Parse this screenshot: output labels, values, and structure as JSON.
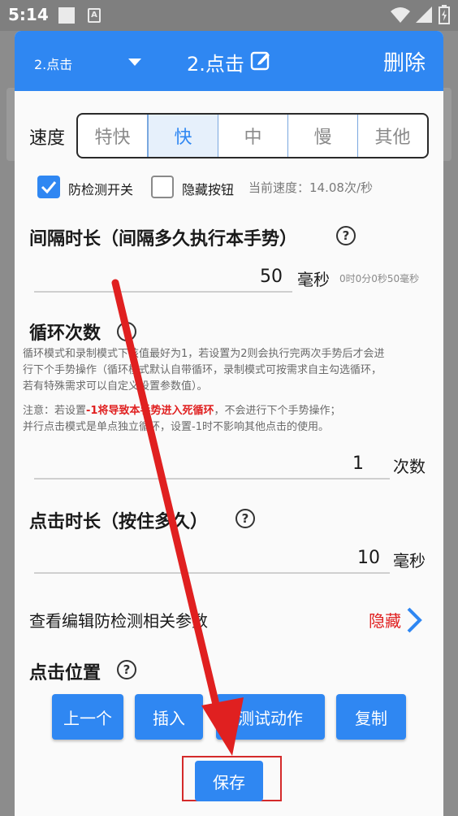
{
  "status_bar": {
    "time": "5:14",
    "notification_letter": "A"
  },
  "header": {
    "gesture_select": "2.点击",
    "title": "2.点击",
    "delete_label": "删除"
  },
  "speed": {
    "label": "速度",
    "options": [
      "特快",
      "快",
      "中",
      "慢",
      "其他"
    ],
    "selected": "快",
    "anti_detect_label": "防检测开关",
    "anti_detect_checked": true,
    "hide_button_label": "隐藏按钮",
    "hide_button_checked": false,
    "current_speed_text": "当前速度：14.08次/秒"
  },
  "interval": {
    "title": "间隔时长（间隔多久执行本手势）",
    "help": "?",
    "value": "50",
    "unit": "毫秒",
    "hint": "0时0分0秒50毫秒"
  },
  "loop": {
    "title": "循环次数",
    "help": "?",
    "desc_line1": "循环模式和录制模式下该值最好为1，若设置为2则会执行完两次手势后才会进",
    "desc_line2": "行下个手势操作（循环模式默认自带循环，录制模式可按需求自主勾选循环，",
    "desc_line3": "若有特殊需求可以自定义设置参数值）。",
    "note_prefix": "注意：若设置",
    "note_red": "-1将导致本手势进入死循环",
    "note_suffix": "，不会进行下个手势操作；",
    "note_line2": "并行点击模式是单点独立循环，设置-1时不影响其他点击的使用。",
    "value": "1",
    "unit": "次数"
  },
  "click_duration": {
    "title": "点击时长（按住多久）",
    "help": "?",
    "value": "10",
    "unit": "毫秒"
  },
  "anti_detect_params": {
    "label": "查看编辑防检测相关参数",
    "toggle_label": "隐藏"
  },
  "click_position": {
    "title": "点击位置",
    "help": "?"
  },
  "actions": {
    "prev_label": "上一个",
    "insert_label": "插入",
    "test_label": "测试动作",
    "copy_label": "复制",
    "save_label": "保存"
  },
  "colors": {
    "primary": "#2f87f2",
    "annotation_red": "#e02020"
  }
}
